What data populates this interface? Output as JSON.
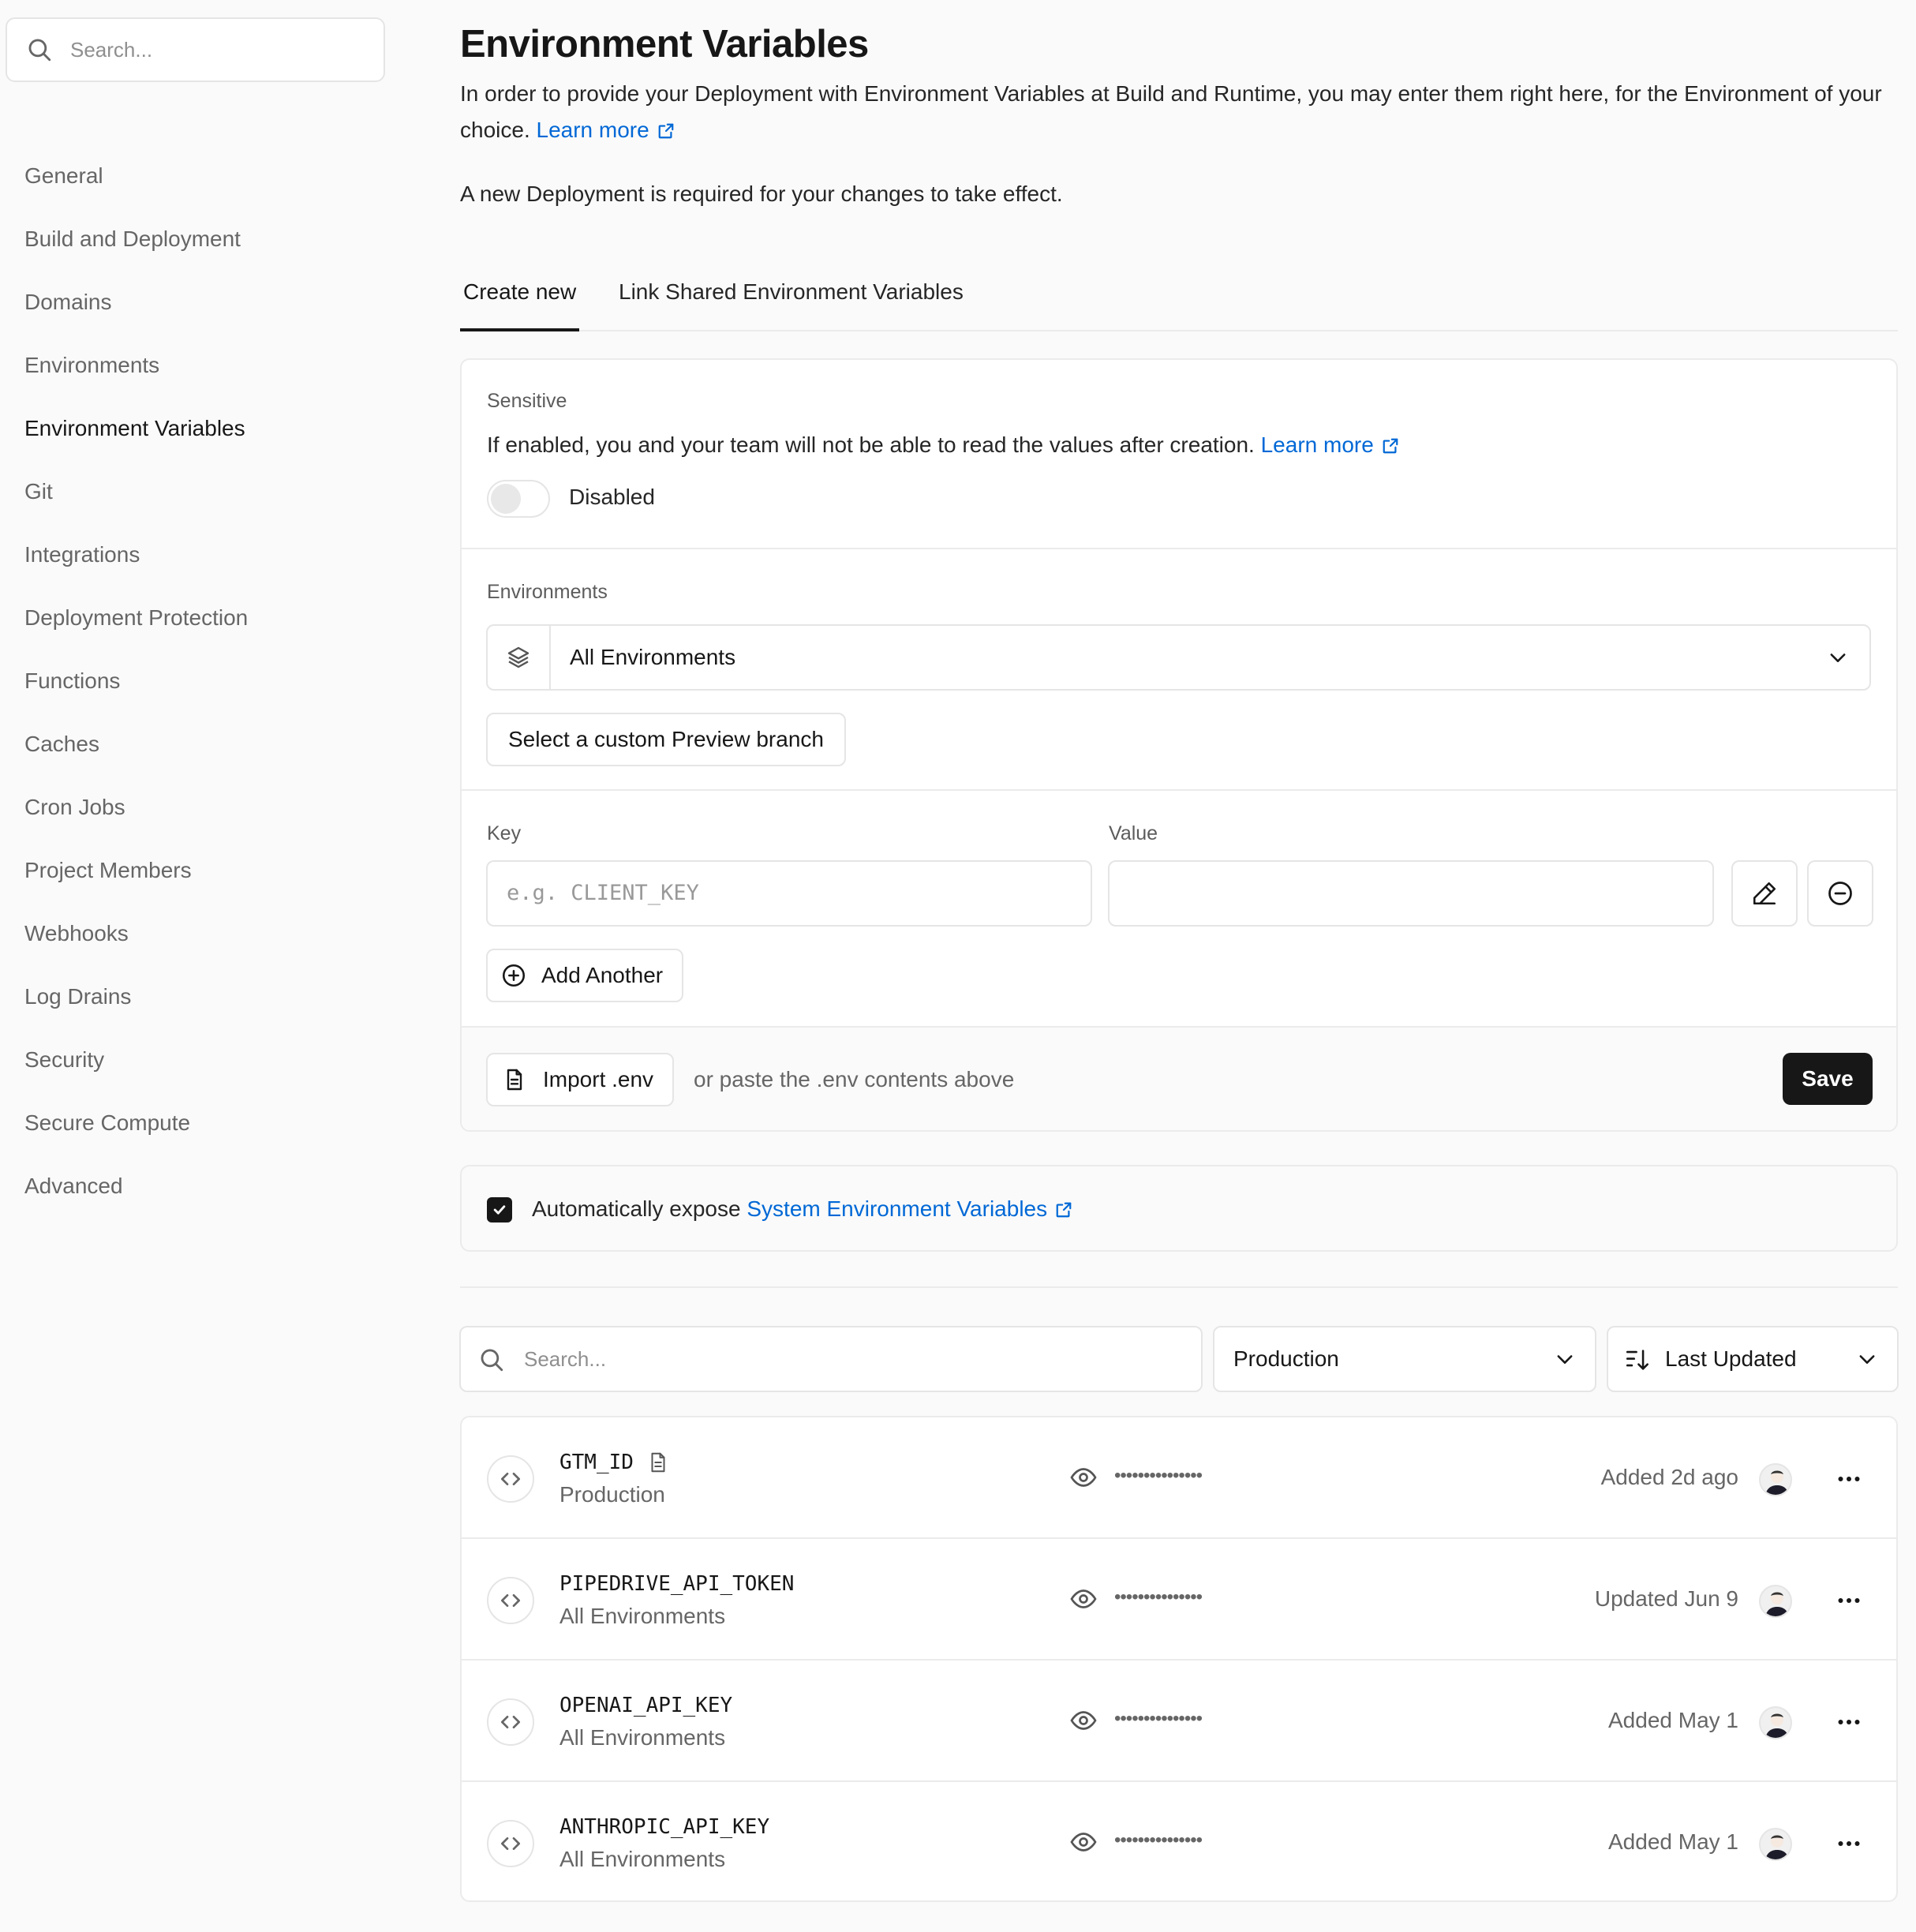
{
  "sidebar": {
    "search_placeholder": "Search...",
    "items": [
      {
        "label": "General"
      },
      {
        "label": "Build and Deployment"
      },
      {
        "label": "Domains"
      },
      {
        "label": "Environments"
      },
      {
        "label": "Environment Variables",
        "active": true
      },
      {
        "label": "Git"
      },
      {
        "label": "Integrations"
      },
      {
        "label": "Deployment Protection"
      },
      {
        "label": "Functions"
      },
      {
        "label": "Caches"
      },
      {
        "label": "Cron Jobs"
      },
      {
        "label": "Project Members"
      },
      {
        "label": "Webhooks"
      },
      {
        "label": "Log Drains"
      },
      {
        "label": "Security"
      },
      {
        "label": "Secure Compute"
      },
      {
        "label": "Advanced"
      }
    ]
  },
  "header": {
    "title": "Environment Variables",
    "description": "In order to provide your Deployment with Environment Variables at Build and Runtime, you may enter them right here, for the Environment of your choice.",
    "learn_more": "Learn more",
    "note": "A new Deployment is required for your changes to take effect."
  },
  "tabs": [
    {
      "label": "Create new",
      "active": true
    },
    {
      "label": "Link Shared Environment Variables"
    }
  ],
  "form": {
    "sensitive": {
      "label": "Sensitive",
      "description": "If enabled, you and your team will not be able to read the values after creation.",
      "learn_more": "Learn more",
      "toggle_state": "Disabled"
    },
    "environments": {
      "label": "Environments",
      "selected": "All Environments",
      "custom_branch_button": "Select a custom Preview branch"
    },
    "key_label": "Key",
    "key_placeholder": "e.g. CLIENT_KEY",
    "value_label": "Value",
    "value": "",
    "add_another": "Add Another",
    "import_button": "Import .env",
    "import_hint": "or paste the .env contents above",
    "save": "Save"
  },
  "auto_expose": {
    "checked": true,
    "text": "Automatically expose",
    "link": "System Environment Variables"
  },
  "filters": {
    "search_placeholder": "Search...",
    "environment": "Production",
    "sort": "Last Updated"
  },
  "variables": [
    {
      "key": "GTM_ID",
      "has_note": true,
      "environment": "Production",
      "value_masked": "•••••••••••••••",
      "meta": "Added 2d ago"
    },
    {
      "key": "PIPEDRIVE_API_TOKEN",
      "has_note": false,
      "environment": "All Environments",
      "value_masked": "•••••••••••••••",
      "meta": "Updated Jun 9"
    },
    {
      "key": "OPENAI_API_KEY",
      "has_note": false,
      "environment": "All Environments",
      "value_masked": "•••••••••••••••",
      "meta": "Added May 1"
    },
    {
      "key": "ANTHROPIC_API_KEY",
      "has_note": false,
      "environment": "All Environments",
      "value_masked": "•••••••••••••••",
      "meta": "Added May 1"
    }
  ],
  "colors": {
    "link": "#0068d6",
    "primary_button": "#171717",
    "border": "#ebebeb",
    "background": "#fafafa"
  }
}
